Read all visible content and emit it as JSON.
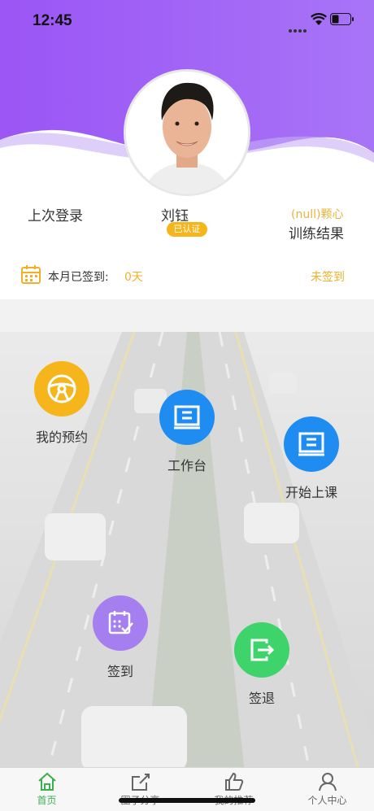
{
  "status_bar": {
    "time": "12:45"
  },
  "profile": {
    "name": "刘钰",
    "verified_badge": "已认证",
    "last_login_label": "上次登录",
    "score_value": "(null)颗心",
    "training_result_label": "训练结果"
  },
  "checkin_bar": {
    "label": "本月已签到:",
    "days": "0天",
    "status": "未签到"
  },
  "functions": {
    "my_booking": "我的预约",
    "workbench": "工作台",
    "start_class": "开始上课",
    "sign_in": "签到",
    "sign_out": "签退"
  },
  "tabbar": {
    "items": [
      {
        "label": "首页",
        "active": true
      },
      {
        "label": "圈子分享",
        "active": false
      },
      {
        "label": "我的推荐",
        "active": false
      },
      {
        "label": "个人中心",
        "active": false
      }
    ]
  },
  "colors": {
    "purple": "#9b5cf6",
    "gold": "#f6b51a",
    "blue": "#1e8cf0",
    "violet": "#a57ef0",
    "green": "#3fd46b",
    "tab_active": "#3cb050"
  }
}
